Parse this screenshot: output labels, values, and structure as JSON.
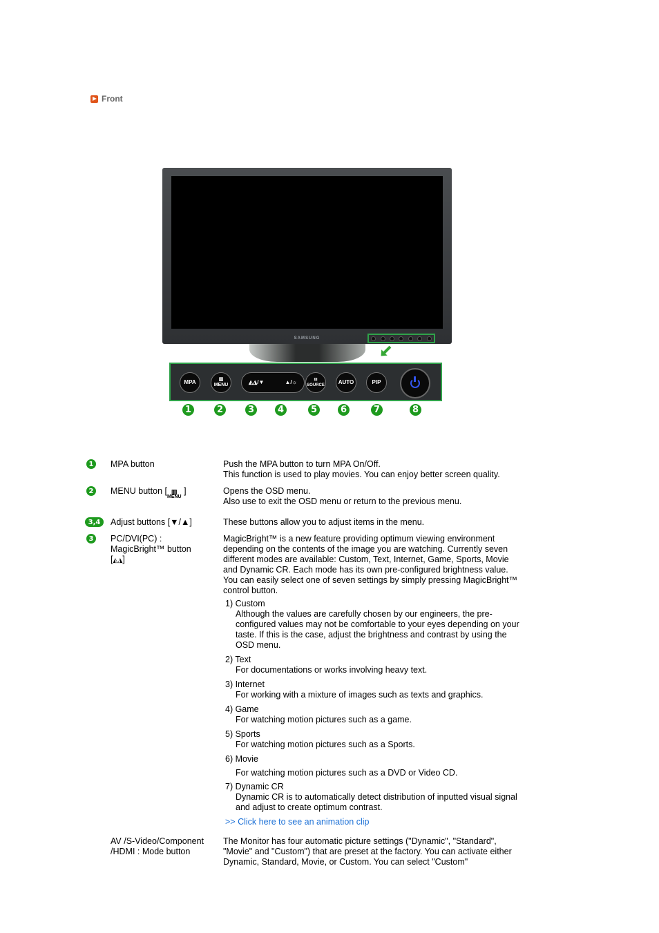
{
  "section": {
    "title": "Front",
    "icon": "play-arrow-icon",
    "accent": "#e0541a"
  },
  "illustration": {
    "brand": "SAMSUNG",
    "highlight_color": "#2fa34a",
    "buttons": [
      {
        "num": "1",
        "label": "MPA"
      },
      {
        "num": "2",
        "label": "MENU",
        "icon": "menu-icon"
      },
      {
        "num": "3",
        "label": "▼",
        "icon": "magicbright-icon"
      },
      {
        "num": "4",
        "label": "▲/☼",
        "icon": "brightness-icon"
      },
      {
        "num": "5",
        "label": "SOURCE",
        "icon": "source-icon"
      },
      {
        "num": "6",
        "label": "AUTO"
      },
      {
        "num": "7",
        "label": "PIP"
      },
      {
        "num": "8",
        "label": "",
        "icon": "power-icon"
      }
    ]
  },
  "items": [
    {
      "badge": "1",
      "term": "MPA button",
      "desc": [
        "Push the MPA button to turn MPA On/Off.",
        "This function is used to play movies. You can enjoy better screen quality."
      ]
    },
    {
      "badge": "2",
      "term": "MENU button [",
      "term_icon_label": "MENU",
      "term_suffix": " ]",
      "desc": [
        "Opens the OSD menu.",
        "Also use to exit the OSD menu or return to the previous menu."
      ]
    },
    {
      "badge": "3,4",
      "term": "Adjust buttons [▼/▲]",
      "desc": [
        "These buttons allow you to adjust items in the menu."
      ]
    },
    {
      "badge": "3",
      "term": "PC/DVI(PC) : MagicBright™ button [",
      "term_suffix": "]",
      "desc": [
        "MagicBright™ is a new feature providing optimum viewing environment depending on the contents of the image you are watching. Currently seven different modes are available: Custom, Text, Internet, Game, Sports, Movie and Dynamic CR. Each mode has its own pre-configured brightness value. You can easily select one of seven settings by simply pressing MagicBright™ control button."
      ],
      "modes": [
        {
          "title": "1) Custom",
          "text": "Although the values are carefully chosen by our engineers, the pre-configured values may not be comfortable to your eyes depending on your taste. If this is the case, adjust the brightness and contrast by using the OSD menu."
        },
        {
          "title": "2) Text",
          "text": "For documentations or works involving heavy text."
        },
        {
          "title": "3) Internet",
          "text": "For working with a mixture of images such as texts and graphics."
        },
        {
          "title": "4) Game",
          "text": "For watching motion pictures such as a game."
        },
        {
          "title": "5) Sports",
          "text": "For watching motion pictures such as a Sports."
        },
        {
          "title": "6) Movie",
          "text": "For watching motion pictures such as a DVD or Video CD."
        },
        {
          "title": "7) Dynamic CR",
          "text": "Dynamic CR is to automatically detect distribution of inputted visual signal and adjust to create optimum contrast."
        }
      ],
      "link": ">> Click here to see an animation clip"
    },
    {
      "badge": "",
      "term": "AV /S-Video/Component /HDMI : Mode button",
      "desc": [
        "The Monitor has four automatic picture settings (\"Dynamic\", \"Standard\", \"Movie\" and \"Custom\") that are preset at the factory. You can activate either Dynamic, Standard, Movie, or Custom. You can select \"Custom\""
      ]
    }
  ]
}
